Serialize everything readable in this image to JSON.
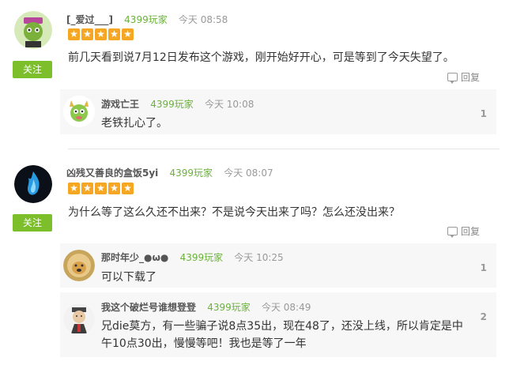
{
  "comments": [
    {
      "username": "[_爱过___]",
      "badge": "4399玩家",
      "time": "今天 08:58",
      "rating": 5,
      "text": "前几天看到说7月12日发布这个游戏，刚开始好开心，可是等到了今天失望了。",
      "follow_label": "关注",
      "reply_label": "回复",
      "avatar_icon": "green-cartoon-avatar",
      "replies": [
        {
          "username": "游戏亡王",
          "badge": "4399玩家",
          "time": "今天 10:08",
          "text": "老铁扎心了。",
          "floor": "1",
          "avatar_icon": "green-dino-avatar"
        }
      ]
    },
    {
      "username": "凶残又善良的盒饭5yi",
      "badge": "4399玩家",
      "time": "今天 08:07",
      "rating": 5,
      "text": "为什么等了这么久还不出来？不是说今天出来了吗？怎么还没出来？",
      "follow_label": "关注",
      "reply_label": "回复",
      "avatar_icon": "blue-flame-avatar",
      "replies": [
        {
          "username": "那时年少_●ω●",
          "badge": "4399玩家",
          "time": "今天 10:25",
          "text": "可以下载了",
          "floor": "1",
          "avatar_icon": "doge-avatar"
        },
        {
          "username": "我这个破烂号谁想登登",
          "badge": "4399玩家",
          "time": "今天 08:49",
          "text_line1": "兄die莫方，有一些骗子说8点35出，现在48了，还没上线，所以肯定是中",
          "text_line2": "午10点30出，慢慢等吧！我也是等了一年",
          "floor": "2",
          "avatar_icon": "cartoon-man-avatar"
        }
      ]
    }
  ],
  "colors": {
    "accent_green": "#7cbf2a",
    "badge_green": "#6ab23a",
    "star": "#f5a623"
  }
}
